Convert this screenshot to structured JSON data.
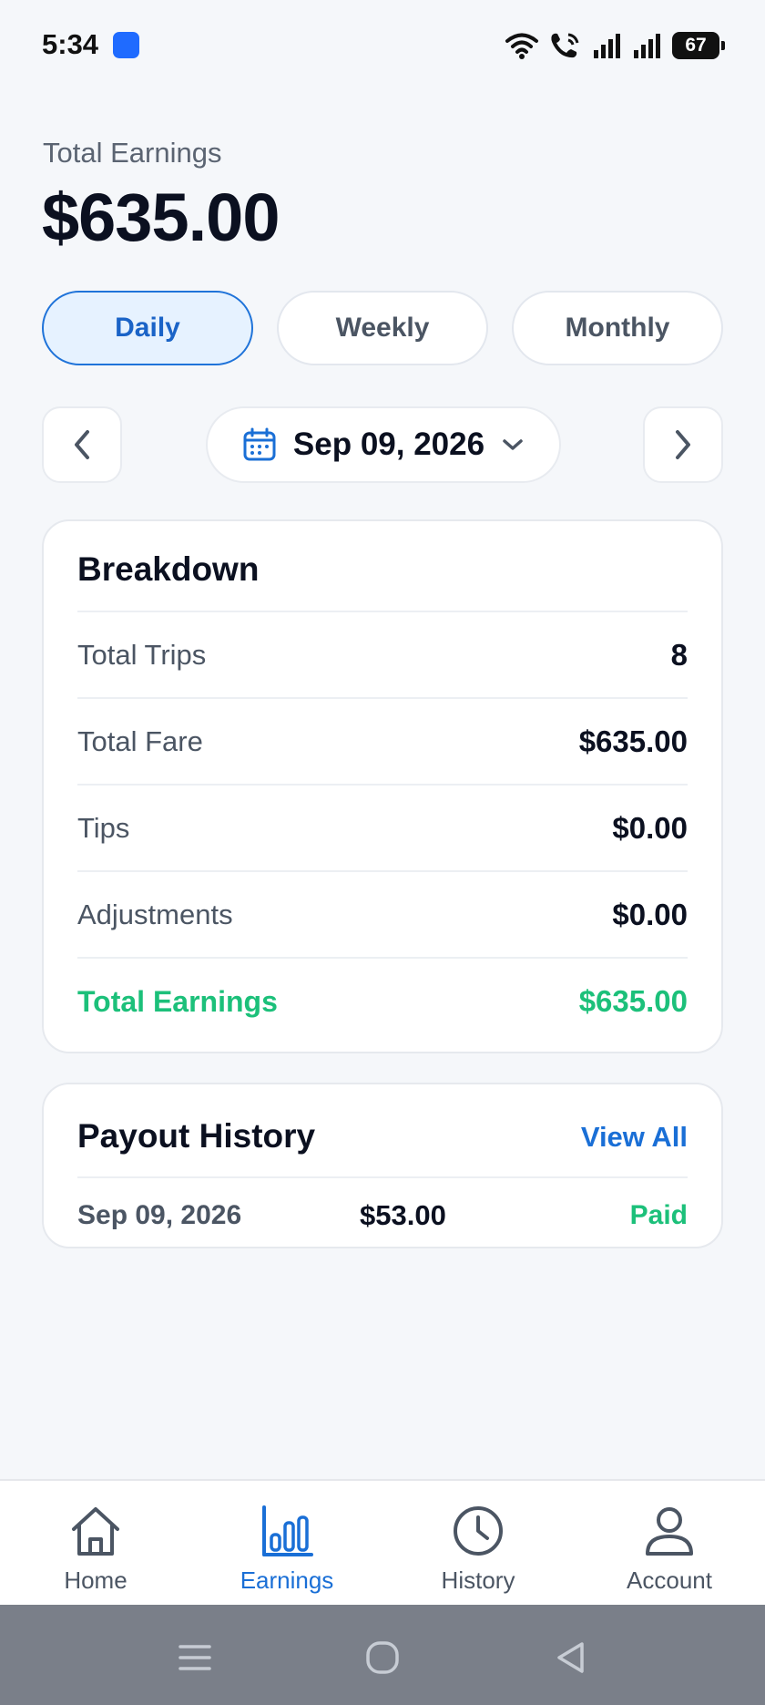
{
  "status": {
    "time": "5:34",
    "battery": "67",
    "app_dot_color": "#1f6bff",
    "icons": [
      "wifi-icon",
      "call-icon",
      "signal-icon",
      "signal-icon",
      "battery-icon"
    ]
  },
  "summary": {
    "label": "Total Earnings",
    "amount": "$635.00"
  },
  "tabs": [
    {
      "label": "Daily",
      "active": true
    },
    {
      "label": "Weekly",
      "active": false
    },
    {
      "label": "Monthly",
      "active": false
    }
  ],
  "date_selector": {
    "date": "Sep 09, 2026",
    "icons": [
      "calendar-icon",
      "chevron-down-icon",
      "chevron-left-icon",
      "chevron-right-icon"
    ]
  },
  "breakdown": {
    "title": "Breakdown",
    "rows": [
      {
        "label": "Total Trips",
        "value": "8"
      },
      {
        "label": "Total Fare",
        "value": "$635.00"
      },
      {
        "label": "Tips",
        "value": "$0.00"
      },
      {
        "label": "Adjustments",
        "value": "$0.00"
      }
    ],
    "total": {
      "label": "Total Earnings",
      "value": "$635.00"
    }
  },
  "payout": {
    "title": "Payout History",
    "view_all": "View All",
    "items": [
      {
        "date": "Sep 09, 2026",
        "amount": "$53.00",
        "status": "Paid"
      }
    ]
  },
  "bottom_nav": [
    {
      "label": "Home",
      "icon": "home-icon",
      "active": false
    },
    {
      "label": "Earnings",
      "icon": "bar-chart-icon",
      "active": true
    },
    {
      "label": "History",
      "icon": "clock-icon",
      "active": false
    },
    {
      "label": "Account",
      "icon": "user-icon",
      "active": false
    }
  ],
  "colors": {
    "accent": "#1a6fd6",
    "success": "#1cc07a",
    "active_tab_bg": "#e6f2ff"
  }
}
